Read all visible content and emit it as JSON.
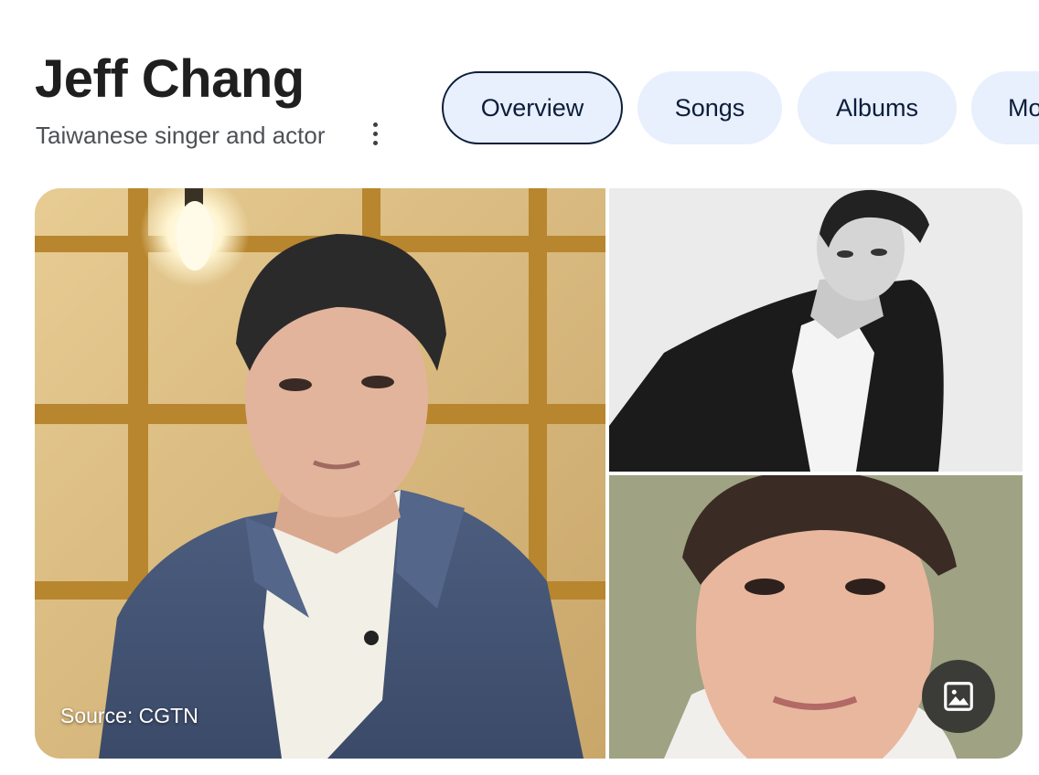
{
  "header": {
    "title": "Jeff Chang",
    "subtitle": "Taiwanese singer and actor",
    "more_icon": "more-vert-icon"
  },
  "tabs": [
    {
      "label": "Overview",
      "active": true
    },
    {
      "label": "Songs",
      "active": false
    },
    {
      "label": "Albums",
      "active": false
    },
    {
      "label": "Mo",
      "active": false
    }
  ],
  "images": {
    "main_source": "Source: CGTN",
    "view_images_icon": "image-icon"
  },
  "colors": {
    "tab_bg": "#e8effd",
    "tab_text": "#0b1d3a",
    "active_border": "#0b1d3a",
    "images_button_bg": "#3b3b38"
  }
}
